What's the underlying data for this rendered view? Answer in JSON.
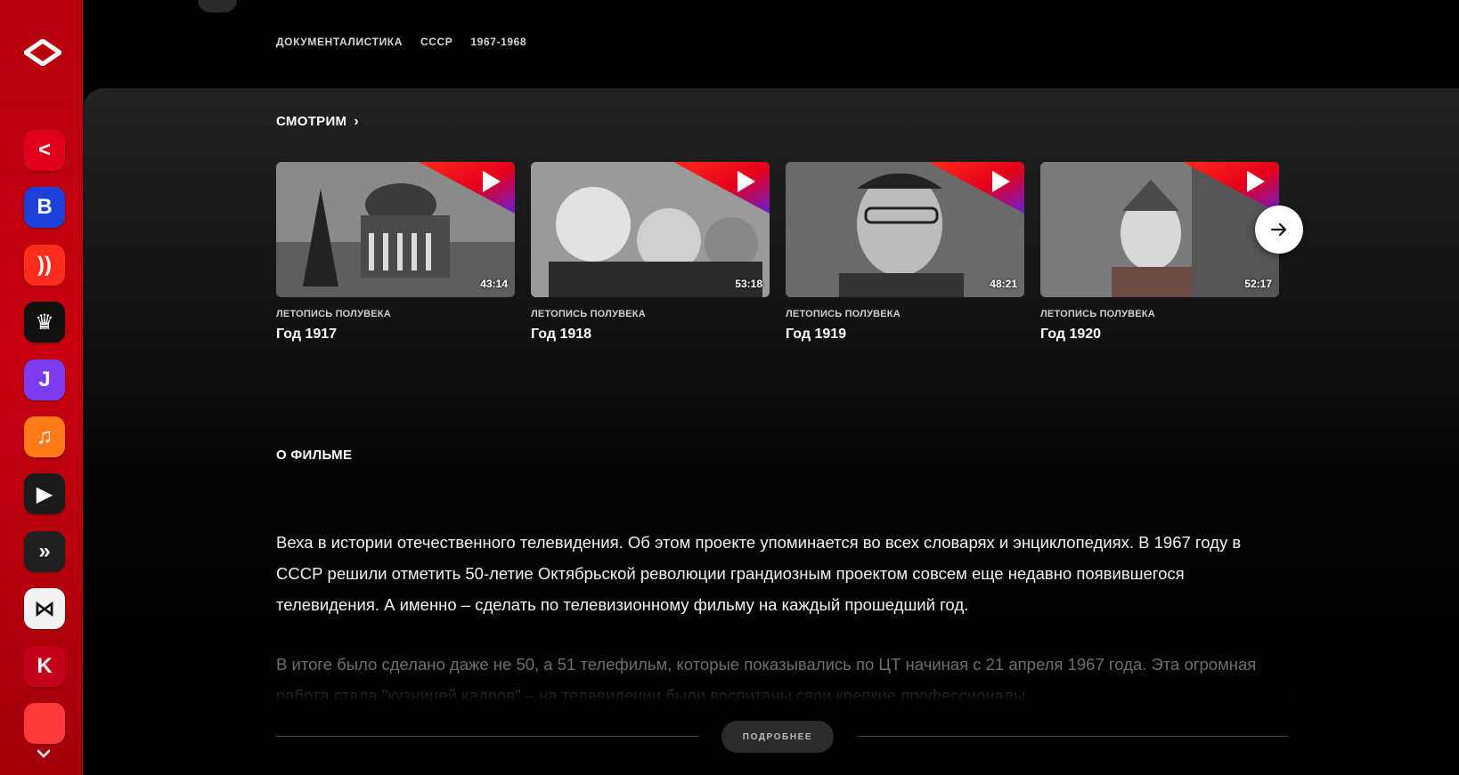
{
  "sidebar": {
    "logo_icon": "okko-logo-icon",
    "apps": [
      {
        "name": "app-icon-1",
        "glyph": "<",
        "bg": "#e0001a"
      },
      {
        "name": "app-icon-2",
        "glyph": "B",
        "bg": "#1e3fd8"
      },
      {
        "name": "app-icon-3",
        "glyph": "))",
        "bg": "#ff2b1c"
      },
      {
        "name": "app-icon-4",
        "glyph": "♛",
        "bg": "#111111"
      },
      {
        "name": "app-icon-5",
        "glyph": "J",
        "bg": "#7b3cf0"
      },
      {
        "name": "app-icon-6",
        "glyph": "♫",
        "bg": "#ff7a18"
      },
      {
        "name": "app-icon-7",
        "glyph": "▶",
        "bg": "#1b1b1b"
      },
      {
        "name": "app-icon-8",
        "glyph": "»",
        "bg": "#202020"
      },
      {
        "name": "app-icon-9",
        "glyph": "⋈",
        "bg": "#f4f4f4"
      },
      {
        "name": "app-icon-10",
        "glyph": "K",
        "bg": "#c4001a"
      },
      {
        "name": "app-icon-11",
        "glyph": "",
        "bg": "#ff3a3a"
      }
    ]
  },
  "header": {
    "meta": [
      "ДОКУМЕНТАЛИСТИКА",
      "СССР",
      "1967-1968"
    ]
  },
  "watching": {
    "title": "СМОТРИМ",
    "arrow": "›",
    "cards": [
      {
        "series": "ЛЕТОПИСЬ ПОЛУВЕКА",
        "title": "Год 1917",
        "duration": "43:14"
      },
      {
        "series": "ЛЕТОПИСЬ ПОЛУВЕКА",
        "title": "Год 1918",
        "duration": "53:18"
      },
      {
        "series": "ЛЕТОПИСЬ ПОЛУВЕКА",
        "title": "Год 1919",
        "duration": "48:21"
      },
      {
        "series": "ЛЕТОПИСЬ ПОЛУВЕКА",
        "title": "Год 1920",
        "duration": "52:17"
      }
    ]
  },
  "about": {
    "title": "О ФИЛЬМЕ",
    "paragraph1": "Веха в истории отечественного телевидения. Об этом проекте упоминается во всех словарях и энциклопедиях. В 1967 году в СССР решили отметить 50-летие Октябрьской революции грандиозным проектом совсем еще недавно появившегося телевидения. А именно – сделать по телевизионному фильму на каждый прошедший год.",
    "paragraph2": "В итоге было сделано даже не 50, а 51 телефильм, которые показывались по ЦТ начиная с 21 апреля 1967 года. Эта огромная работа стала \"кузницей кадров\" – на телевидении были воспитаны свои крепкие профессионалы.",
    "more_label": "ПОДРОБНЕЕ"
  },
  "colors": {
    "accent": "#e3001b",
    "badge_purple": "#6a1bd6"
  }
}
